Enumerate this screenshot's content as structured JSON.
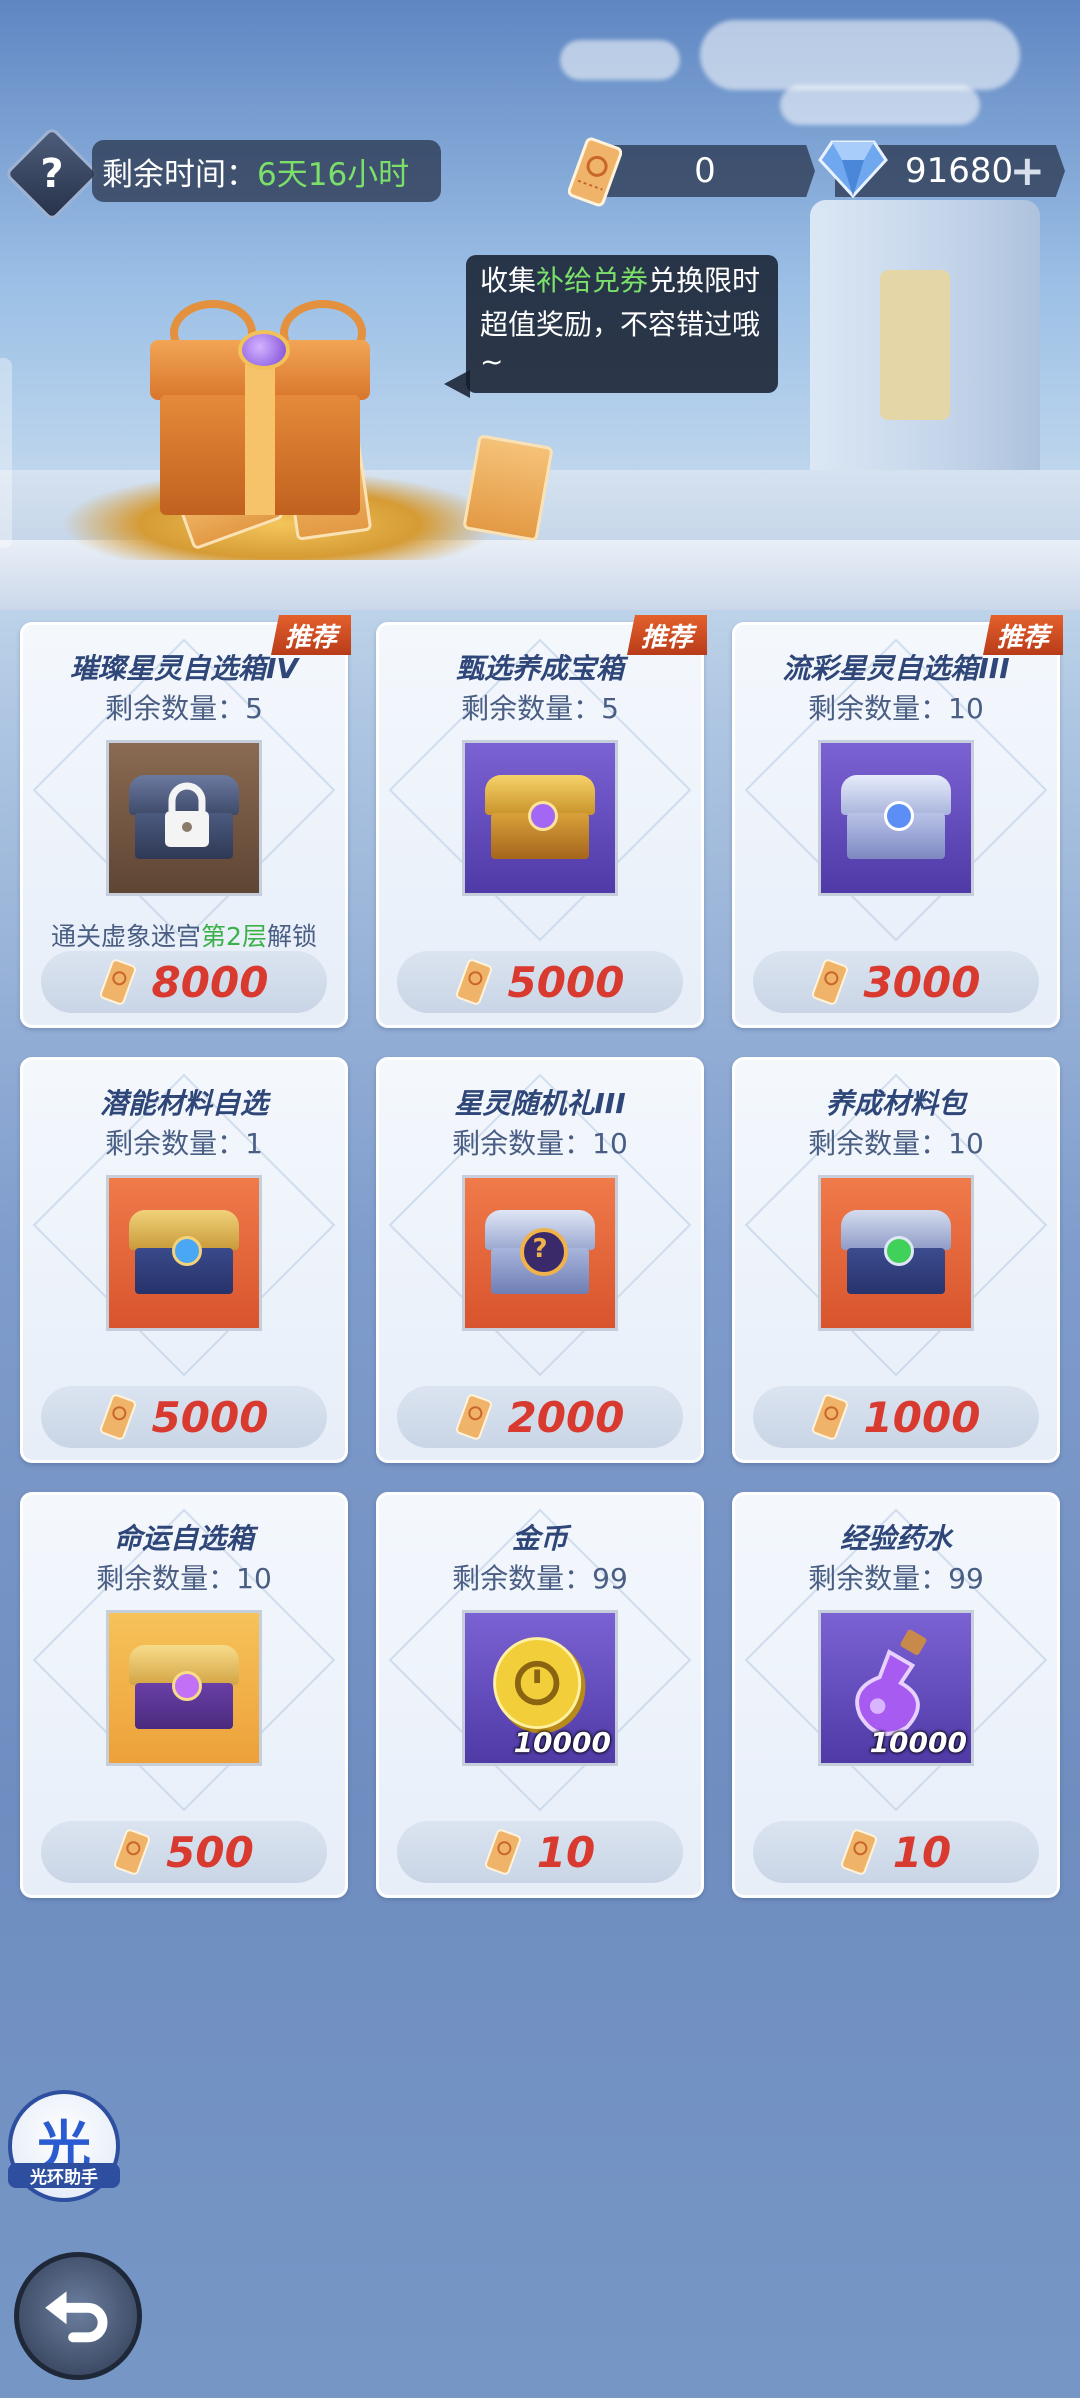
{
  "header": {
    "timer_label": "剩余时间：",
    "timer_value": "6天16小时",
    "ticket_amount": "0",
    "gem_amount": "91680",
    "plus": "+",
    "help": "?"
  },
  "bubble": {
    "line1_pre": "收集",
    "line1_highlight": "补给兑券",
    "line1_post": "兑换限时",
    "line2": "超值奖励，不容错过哦",
    "line3": "~"
  },
  "products": [
    {
      "title": "璀璨星灵自选箱IV",
      "stock": "剩余数量：5",
      "price": "8000",
      "tag": "推荐",
      "unlock_pre": "通关虚象迷宫",
      "unlock_hl": "第2层",
      "unlock_post": "解锁"
    },
    {
      "title": "甄选养成宝箱",
      "stock": "剩余数量：5",
      "price": "5000",
      "tag": "推荐"
    },
    {
      "title": "流彩星灵自选箱III",
      "stock": "剩余数量：10",
      "price": "3000",
      "tag": "推荐"
    },
    {
      "title": "潜能材料自选",
      "stock": "剩余数量：1",
      "price": "5000"
    },
    {
      "title": "星灵随机礼III",
      "stock": "剩余数量：10",
      "price": "2000"
    },
    {
      "title": "养成材料包",
      "stock": "剩余数量：10",
      "price": "1000"
    },
    {
      "title": "命运自选箱",
      "stock": "剩余数量：10",
      "price": "500"
    },
    {
      "title": "金币",
      "stock": "剩余数量：99",
      "price": "10",
      "qty": "10000"
    },
    {
      "title": "经验药水",
      "stock": "剩余数量：99",
      "price": "10",
      "qty": "10000"
    }
  ],
  "assistant": {
    "char": "光",
    "label": "光环助手"
  },
  "icons": {
    "help": "question-icon",
    "ticket": "ticket-icon",
    "gem": "diamond-icon",
    "back": "back-arrow-icon"
  }
}
